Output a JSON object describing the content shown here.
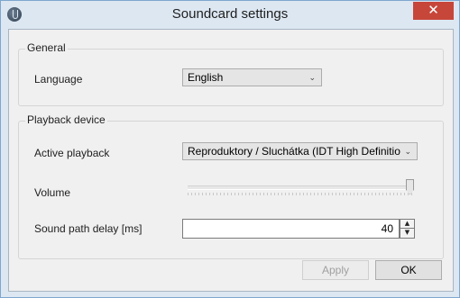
{
  "window": {
    "title": "Soundcard settings",
    "close_glyph": "✕",
    "icon": "speaker-app-icon"
  },
  "general": {
    "group_title": "General",
    "language_label": "Language",
    "language_value": "English"
  },
  "playback": {
    "group_title": "Playback device",
    "active_label": "Active playback",
    "active_value": "Reproduktory / Sluchátka (IDT High Definitio",
    "volume_label": "Volume",
    "volume_level": 1.0,
    "delay_label": "Sound path delay [ms]",
    "delay_value": "40"
  },
  "buttons": {
    "apply": "Apply",
    "ok": "OK"
  },
  "glyphs": {
    "dropdown": "⌄",
    "spin_up": "▲",
    "spin_down": "▼"
  }
}
